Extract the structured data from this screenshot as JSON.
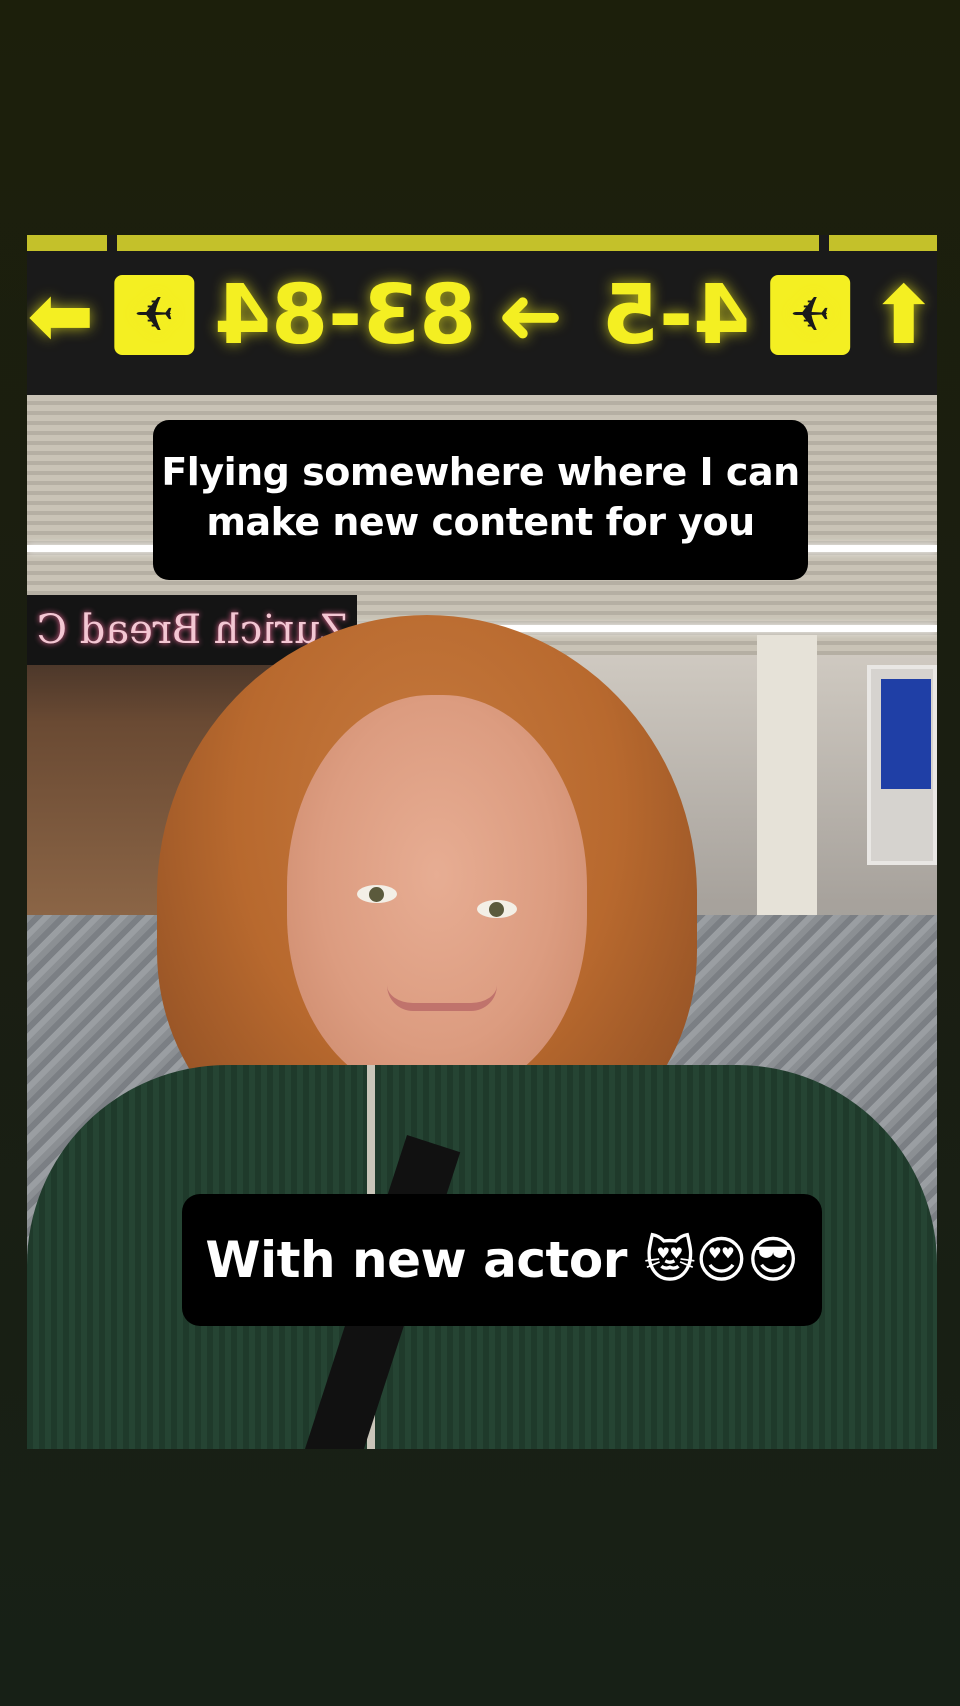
{
  "story": {
    "caption_top": "Flying somewhere where I can make new content for you",
    "caption_bottom": "With new actor 😻😍😎"
  },
  "scene": {
    "sign_left": "83-84",
    "sign_right": "4-5",
    "cafe_sign": "Zurich Bread C"
  }
}
